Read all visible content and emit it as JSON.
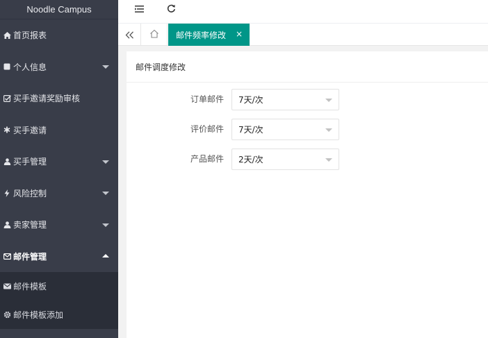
{
  "app": {
    "brand": "Noodle Campus"
  },
  "sidebar": {
    "items": [
      {
        "label": "首页报表",
        "icon": "home-icon"
      },
      {
        "label": "个人信息",
        "icon": "square-icon",
        "has_children": true
      },
      {
        "label": "买手邀请奖励审核",
        "icon": "checkbox-icon"
      },
      {
        "label": "买手邀请",
        "icon": "asterisk-icon"
      },
      {
        "label": "买手管理",
        "icon": "users-icon",
        "has_children": true
      },
      {
        "label": "风险控制",
        "icon": "bolt-icon",
        "has_children": true
      },
      {
        "label": "卖家管理",
        "icon": "user-icon",
        "has_children": true
      },
      {
        "label": "邮件管理",
        "icon": "envelope-outline-icon",
        "has_children": true,
        "open": true
      }
    ],
    "subitems": [
      {
        "label": "邮件模板",
        "icon": "envelope-icon"
      },
      {
        "label": "邮件模板添加",
        "icon": "gear-icon"
      }
    ]
  },
  "tabs": {
    "active": {
      "label": "邮件频率修改",
      "close": "×"
    }
  },
  "card": {
    "title": "邮件调度修改",
    "fields": [
      {
        "label": "订单邮件",
        "value": "7天/次"
      },
      {
        "label": "评价邮件",
        "value": "7天/次"
      },
      {
        "label": "产品邮件",
        "value": "2天/次"
      }
    ]
  },
  "colors": {
    "sidebar_bg": "#393d49",
    "submenu_bg": "#2a2e38",
    "accent": "#009688",
    "content_bg": "#f2f2f2"
  }
}
